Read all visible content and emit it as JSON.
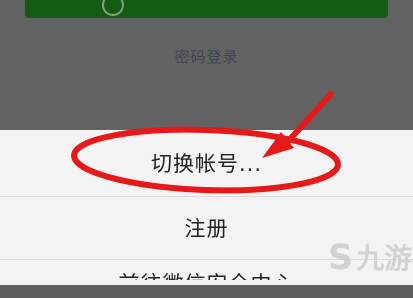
{
  "header": {
    "primary_button_label": "",
    "password_login_label": "密码登录"
  },
  "sheet": {
    "items": [
      {
        "label": "切换帐号..."
      },
      {
        "label": "注册"
      },
      {
        "label": "前往微信安全中心"
      }
    ]
  },
  "watermark": {
    "symbol": "S",
    "text": "九游"
  },
  "colors": {
    "backdrop": "#5f5f5f",
    "sheet_background": "#f3f3f3",
    "primary_green": "#145c14",
    "annotation_red": "#e51919"
  }
}
